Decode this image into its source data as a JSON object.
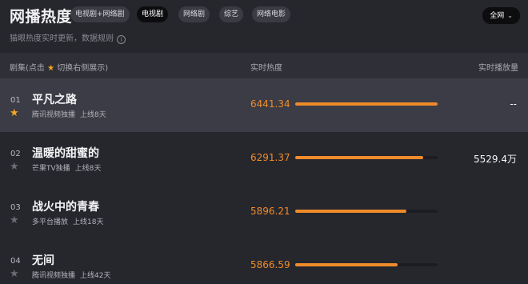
{
  "header": {
    "title": "网播热度",
    "tabs": [
      {
        "label": "电视剧+网络剧",
        "active": false
      },
      {
        "label": "电视剧",
        "active": true
      },
      {
        "label": "网络剧",
        "active": false
      },
      {
        "label": "综艺",
        "active": false
      },
      {
        "label": "网络电影",
        "active": false
      }
    ],
    "region_label": "全网",
    "subtitle": "猫眼热度实时更新，数据规则",
    "info_icon": "info-icon"
  },
  "columns": {
    "series_prefix": "剧集(点击",
    "series_star": "★",
    "series_suffix": "切换右侧展示)",
    "heat": "实时热度",
    "play": "实时播放量"
  },
  "colors": {
    "accent": "#f08b2a",
    "star_active": "#f5a623",
    "star_inactive": "#6b6c74"
  },
  "rows": [
    {
      "rank": "01",
      "name": "平凡之路",
      "platform": "腾讯视频独播",
      "online": "上线8天",
      "heat": "6441.34",
      "bar_fraction": 1.0,
      "starred": true,
      "play": "--"
    },
    {
      "rank": "02",
      "name": "温暖的甜蜜的",
      "platform": "芒果TV独播",
      "online": "上线8天",
      "heat": "6291.37",
      "bar_fraction": 0.9,
      "starred": false,
      "play": "5529.4万"
    },
    {
      "rank": "03",
      "name": "战火中的青春",
      "platform": "多平台播放",
      "online": "上线18天",
      "heat": "5896.21",
      "bar_fraction": 0.78,
      "starred": false,
      "play": ""
    },
    {
      "rank": "04",
      "name": "无间",
      "platform": "腾讯视频独播",
      "online": "上线42天",
      "heat": "5866.59",
      "bar_fraction": 0.72,
      "starred": false,
      "play": ""
    }
  ]
}
